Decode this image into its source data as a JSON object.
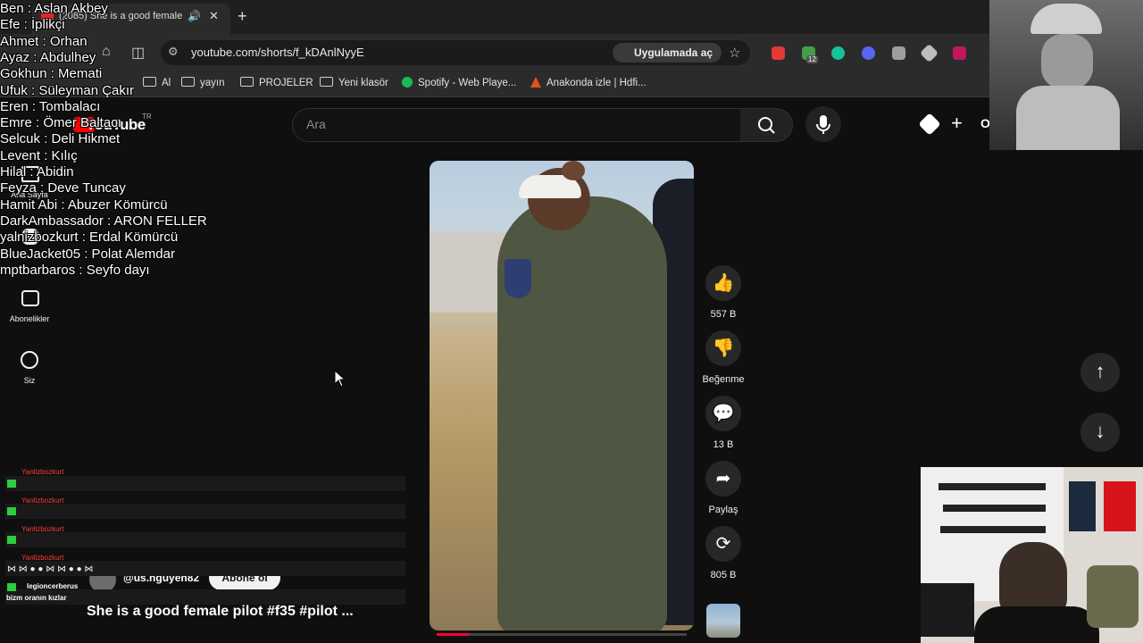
{
  "browser": {
    "tab_title": "(2085) She is a good female",
    "url": "youtube.com/shorts/f_kDAnlNyyE",
    "open_in_app": "Uygulamada aç",
    "bookmarks": [
      "Al",
      "yayın",
      "PROJELER",
      "Yeni klasör",
      "Spotify - Web Playe...",
      "Anakonda izle | Hdfi..."
    ],
    "extension_badge": "12"
  },
  "youtube": {
    "logo": "YouTube",
    "country": "TR",
    "search_placeholder": "Ara",
    "create_label": "O",
    "sidebar": {
      "home": "Ana Sayfa",
      "subscriptions": "Abonelikler",
      "you": "Siz"
    },
    "actions": {
      "likes": "557 B",
      "dislike": "Beğenme",
      "comments": "13 B",
      "share": "Paylaş",
      "remix": "805 B"
    },
    "short": {
      "channel": "@us.nguyen82",
      "subscribe": "Abone ol",
      "title": "She is a good female pilot #f35 #pilot ..."
    }
  },
  "overlay_list": [
    "Ben : Aslan Akbey",
    "Efe : İplikçi",
    "Ahmet : Orhan",
    "Ayaz : Abdulhey",
    "Gokhun : Memati",
    "Ufuk : Süleyman Çakır",
    "Eren : Tombalacı",
    "Emre : Ömer Baltacı",
    "Selcuk : Deli Hikmet",
    "Levent : Kılıç",
    "Hilal : Abidin",
    "Feyza : Deve Tuncay",
    "Hamit Abi : Abuzer Kömürcü",
    "DarkAmbassador : ARON FELLER",
    "yalnizbozkurt : Erdal Kömürcü",
    "BlueJacket05 : Polat Alemdar",
    "mptbarbaros : Seyfo dayı"
  ],
  "chat": {
    "users": [
      "Yanlizbozkurt",
      "Yanlizbozkurt",
      "Yanlizbozkurt",
      "Yanlizbozkurt"
    ],
    "last_user": "legioncerberus",
    "last_message": "bizm oranın kızlar"
  },
  "colors": {
    "yt_red": "#ff0000",
    "bg": "#0f0f0f",
    "chat_name": "#ff3b3b"
  }
}
